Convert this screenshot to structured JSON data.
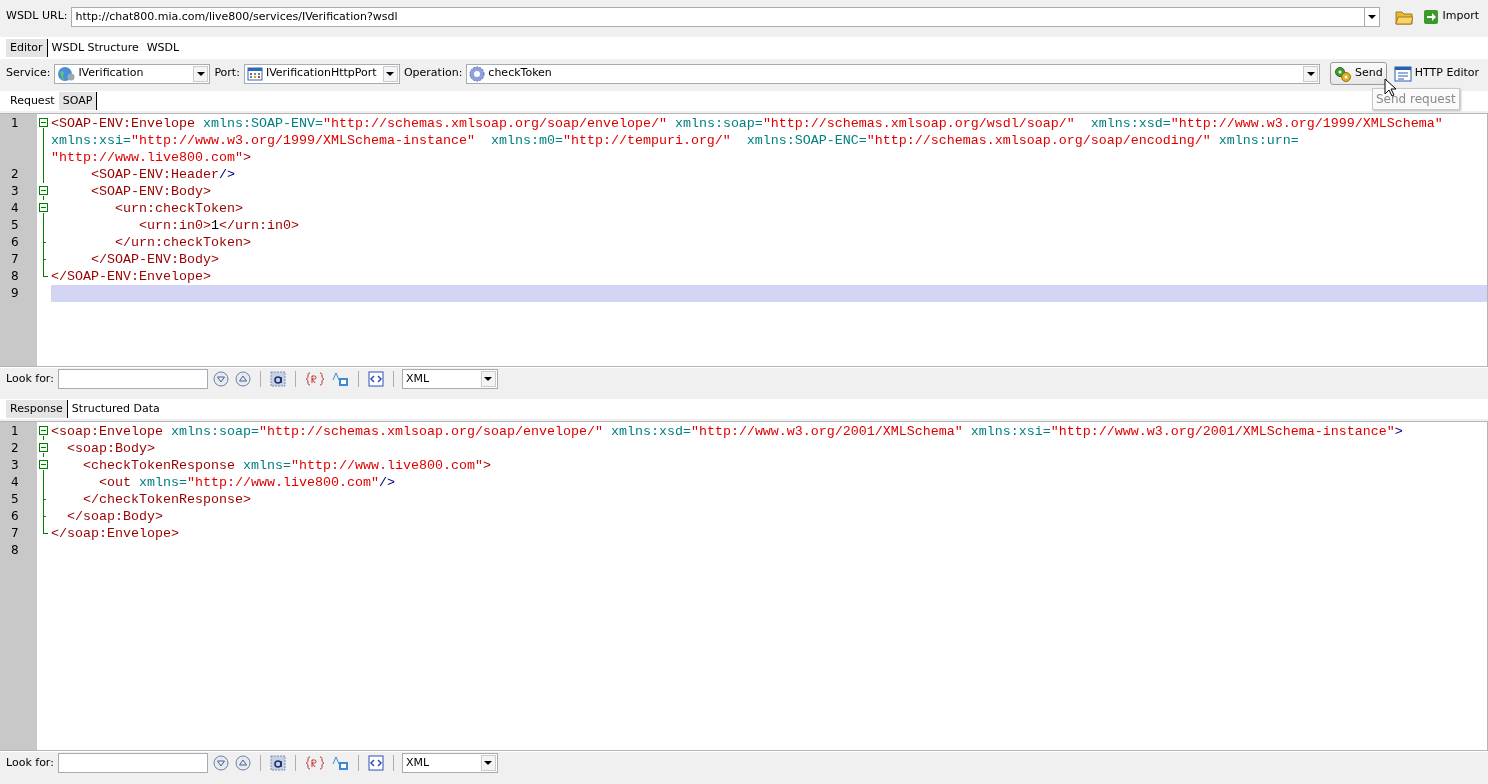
{
  "wsdl_bar": {
    "label": "WSDL URL:",
    "url": "http://chat800.mia.com/live800/services/IVerification?wsdl",
    "import_button": "Import"
  },
  "main_tabs": [
    {
      "label": "Editor",
      "selected": true
    },
    {
      "label": "WSDL Structure",
      "selected": false
    },
    {
      "label": "WSDL",
      "selected": false
    }
  ],
  "operation_bar": {
    "service_label": "Service:",
    "service": "IVerification",
    "port_label": "Port:",
    "port": "IVerificationHttpPort",
    "operation_label": "Operation:",
    "operation": "checkToken",
    "send_button": "Send",
    "http_editor_button": "HTTP Editor",
    "tooltip": "Send request"
  },
  "request_tabs": [
    {
      "label": "Request",
      "selected": false
    },
    {
      "label": "SOAP",
      "selected": true
    }
  ],
  "request_editor": {
    "lines": [
      {
        "number": "1",
        "kind": "box",
        "current": false,
        "rows": [
          [
            {
              "kind": "tag",
              "text": "<SOAP-ENV:Envelope"
            },
            {
              "kind": "attr",
              "text": " xmlns:SOAP-ENV="
            },
            {
              "kind": "value",
              "text": "\"http://schemas.xmlsoap.org/soap/envelope/\""
            },
            {
              "kind": "attr",
              "text": " xmlns:soap="
            },
            {
              "kind": "value",
              "text": "\"http://schemas.xmlsoap.org/wsdl/soap/\""
            },
            {
              "kind": "attr",
              "text": "  xmlns:xsd="
            },
            {
              "kind": "value",
              "text": "\"http://www.w3.org/1999/XMLSchema\""
            }
          ],
          [
            {
              "kind": "attr",
              "text": "xmlns:xsi="
            },
            {
              "kind": "value",
              "text": "\"http://www.w3.org/1999/XMLSchema-instance\""
            },
            {
              "kind": "attr",
              "text": "  xmlns:m0="
            },
            {
              "kind": "value",
              "text": "\"http://tempuri.org/\""
            },
            {
              "kind": "attr",
              "text": "  xmlns:SOAP-ENC="
            },
            {
              "kind": "value",
              "text": "\"http://schemas.xmlsoap.org/soap/encoding/\""
            },
            {
              "kind": "attr",
              "text": " xmlns:urn="
            }
          ],
          [
            {
              "kind": "value",
              "text": "\"http://www.live800.com\""
            },
            {
              "kind": "tag",
              "text": ">"
            }
          ]
        ]
      },
      {
        "number": "2",
        "kind": "line",
        "current": false,
        "rows": [
          [
            {
              "kind": "tag",
              "text": "     <SOAP-ENV:Header"
            },
            {
              "kind": "punct",
              "text": "/>"
            }
          ]
        ]
      },
      {
        "number": "3",
        "kind": "box",
        "current": false,
        "rows": [
          [
            {
              "kind": "tag",
              "text": "     <SOAP-ENV:Body>"
            }
          ]
        ]
      },
      {
        "number": "4",
        "kind": "box",
        "current": false,
        "rows": [
          [
            {
              "kind": "tag",
              "text": "        <urn:checkToken>"
            }
          ]
        ]
      },
      {
        "number": "5",
        "kind": "line",
        "current": false,
        "rows": [
          [
            {
              "kind": "tag",
              "text": "           <urn:in0>"
            },
            {
              "kind": "text",
              "text": "1"
            },
            {
              "kind": "tag",
              "text": "</urn:in0>"
            }
          ]
        ]
      },
      {
        "number": "6",
        "kind": "tick",
        "current": false,
        "rows": [
          [
            {
              "kind": "tag",
              "text": "        </urn:checkToken>"
            }
          ]
        ]
      },
      {
        "number": "7",
        "kind": "tick",
        "current": false,
        "rows": [
          [
            {
              "kind": "tag",
              "text": "     </SOAP-ENV:Body>"
            }
          ]
        ]
      },
      {
        "number": "8",
        "kind": "corner",
        "current": false,
        "rows": [
          [
            {
              "kind": "tag",
              "text": "</SOAP-ENV:Envelope>"
            }
          ]
        ]
      },
      {
        "number": "9",
        "kind": "none",
        "current": true,
        "rows": [
          []
        ]
      }
    ]
  },
  "request_search": {
    "label": "Look for:",
    "format": "XML"
  },
  "response_tabs": [
    {
      "label": "Response",
      "selected": true
    },
    {
      "label": "Structured Data",
      "selected": false
    }
  ],
  "response_editor": {
    "lines": [
      {
        "number": "1",
        "kind": "box",
        "current": false,
        "rows": [
          [
            {
              "kind": "tag",
              "text": "<soap:Envelope"
            },
            {
              "kind": "attr",
              "text": " xmlns:soap="
            },
            {
              "kind": "value",
              "text": "\"http://schemas.xmlsoap.org/soap/envelope/\""
            },
            {
              "kind": "attr",
              "text": " xmlns:xsd="
            },
            {
              "kind": "value",
              "text": "\"http://www.w3.org/2001/XMLSchema\""
            },
            {
              "kind": "attr",
              "text": " xmlns:xsi="
            },
            {
              "kind": "value",
              "text": "\"http://www.w3.org/2001/XMLSchema-instance\""
            },
            {
              "kind": "punct",
              "text": ">"
            }
          ]
        ]
      },
      {
        "number": "2",
        "kind": "box",
        "current": false,
        "rows": [
          [
            {
              "kind": "tag",
              "text": "  <soap:Body>"
            }
          ]
        ]
      },
      {
        "number": "3",
        "kind": "box",
        "current": false,
        "rows": [
          [
            {
              "kind": "tag",
              "text": "    <checkTokenResponse"
            },
            {
              "kind": "attr",
              "text": " xmlns="
            },
            {
              "kind": "value",
              "text": "\"http://www.live800.com\""
            },
            {
              "kind": "tag",
              "text": ">"
            }
          ]
        ]
      },
      {
        "number": "4",
        "kind": "line",
        "current": false,
        "rows": [
          [
            {
              "kind": "tag",
              "text": "      <out"
            },
            {
              "kind": "attr",
              "text": " xmlns="
            },
            {
              "kind": "value",
              "text": "\"http://www.live800.com\""
            },
            {
              "kind": "punct",
              "text": "/>"
            }
          ]
        ]
      },
      {
        "number": "5",
        "kind": "tick",
        "current": false,
        "rows": [
          [
            {
              "kind": "tag",
              "text": "    </checkTokenResponse>"
            }
          ]
        ]
      },
      {
        "number": "6",
        "kind": "tick",
        "current": false,
        "rows": [
          [
            {
              "kind": "tag",
              "text": "  </soap:Body>"
            }
          ]
        ]
      },
      {
        "number": "7",
        "kind": "corner",
        "current": false,
        "rows": [
          [
            {
              "kind": "tag",
              "text": "</soap:Envelope>"
            }
          ]
        ]
      },
      {
        "number": "8",
        "kind": "none",
        "current": false,
        "rows": [
          []
        ]
      }
    ]
  },
  "response_search": {
    "label": "Look for:",
    "format": "XML"
  }
}
